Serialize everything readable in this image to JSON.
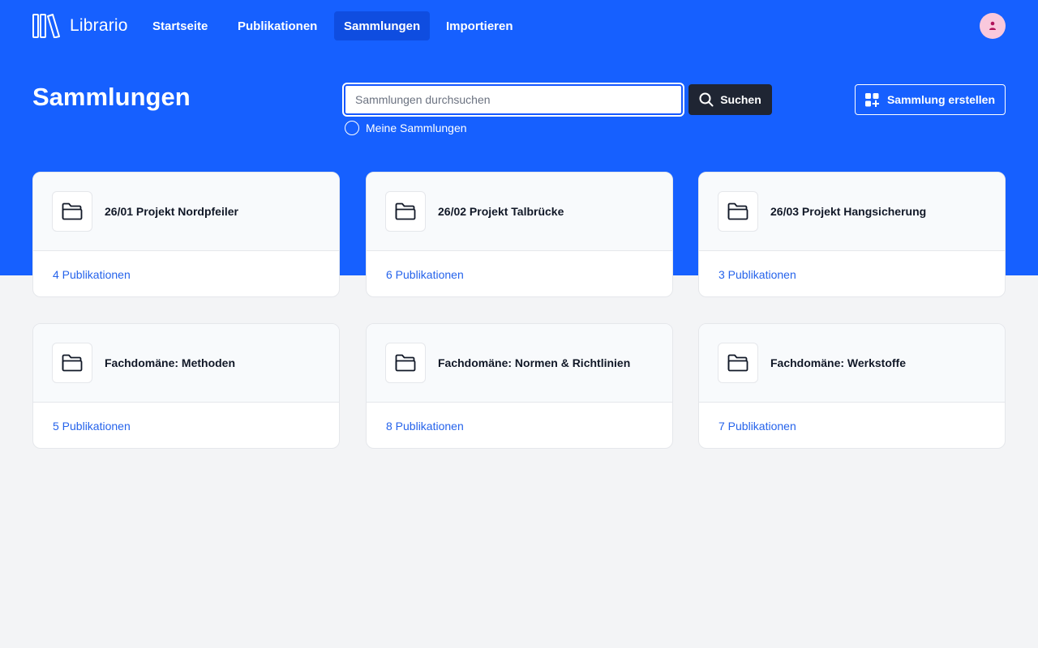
{
  "app": {
    "name": "Librario"
  },
  "nav": {
    "items": [
      {
        "label": "Startseite"
      },
      {
        "label": "Publikationen"
      },
      {
        "label": "Sammlungen"
      },
      {
        "label": "Importieren"
      }
    ],
    "active": "Sammlungen"
  },
  "page": {
    "title": "Sammlungen"
  },
  "search": {
    "placeholder": "Sammlungen durchsuchen",
    "value": "",
    "button_label": "Suchen"
  },
  "filter": {
    "my_collections_label": "Meine Sammlungen",
    "checked": false
  },
  "create": {
    "label": "Sammlung erstellen"
  },
  "collections": [
    {
      "name": "26/01 Projekt Nordpfeiler",
      "count": "4 Publikationen"
    },
    {
      "name": "26/02 Projekt Talbrücke",
      "count": "6 Publikationen"
    },
    {
      "name": "26/03 Projekt Hangsicherung",
      "count": "3 Publikationen"
    },
    {
      "name": "Fachdomäne: Methoden",
      "count": "5 Publikationen"
    },
    {
      "name": "Fachdomäne: Normen & Richtlinien",
      "count": "8 Publikationen"
    },
    {
      "name": "Fachdomäne: Werkstoffe",
      "count": "7 Publikationen"
    }
  ],
  "colors": {
    "brand": "#1660ff",
    "nav_active": "#0f4de0",
    "search_button": "#1f2533",
    "link": "#2563eb",
    "avatar_bg": "#f9c8dc",
    "avatar_fg": "#b0125a"
  },
  "icons": {
    "logo": "books-logo-icon",
    "avatar": "user-icon",
    "search": "search-icon",
    "create": "add-grid-icon",
    "collection": "folder-icon"
  }
}
